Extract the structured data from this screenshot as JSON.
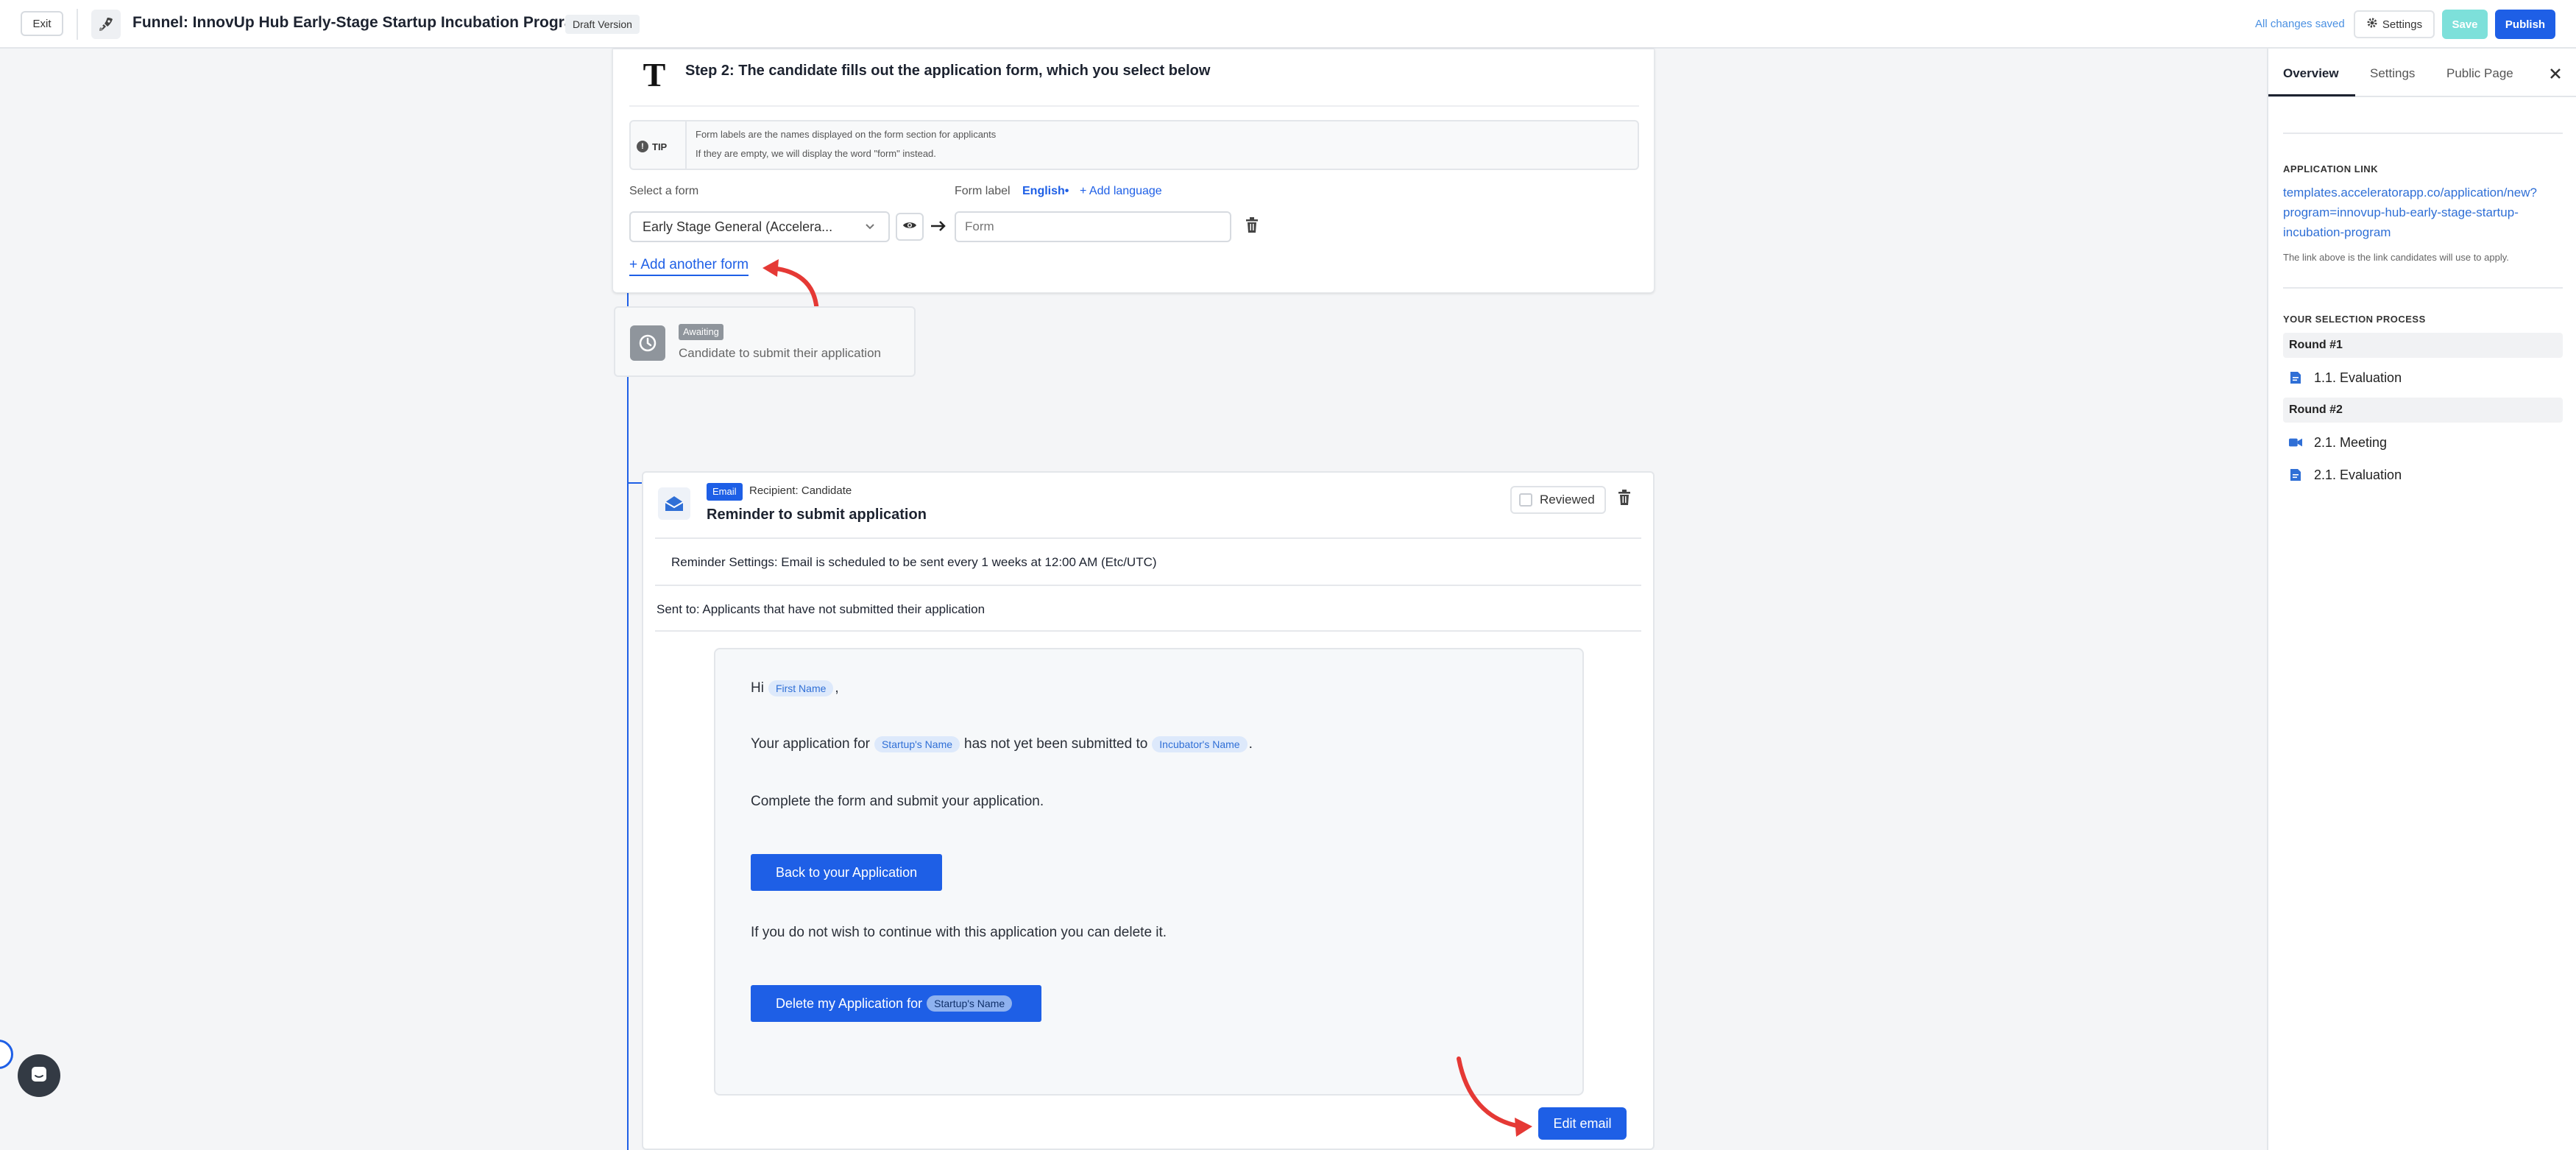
{
  "header": {
    "exit_label": "Exit",
    "title": "Funnel: InnovUp Hub Early-Stage Startup Incubation Program",
    "draft_label": "Draft Version",
    "saved_status": "All changes saved",
    "settings_label": "Settings",
    "save_label": "Save",
    "publish_label": "Publish"
  },
  "sidebar": {
    "tabs": [
      {
        "label": "Overview",
        "active": true
      },
      {
        "label": "Settings",
        "active": false
      },
      {
        "label": "Public Page",
        "active": false
      }
    ],
    "application_link_heading": "APPLICATION LINK",
    "application_link": "templates.acceleratorapp.co/application/new?program=innovup-hub-early-stage-startup-incubation-program",
    "application_link_note": "The link above is the link candidates will use to apply.",
    "selection_heading": "YOUR SELECTION PROCESS",
    "rounds": [
      {
        "label": "Round #1",
        "steps": [
          {
            "label": "1.1. Evaluation",
            "icon": "document-icon"
          }
        ]
      },
      {
        "label": "Round #2",
        "steps": [
          {
            "label": "2.1. Meeting",
            "icon": "video-camera-icon"
          },
          {
            "label": "2.1. Evaluation",
            "icon": "document-icon"
          }
        ]
      }
    ]
  },
  "step2": {
    "icon_letter": "T",
    "title": "Step 2: The candidate fills out the application form, which you select below",
    "tip_label": "TIP",
    "tip_line1": "Form labels are the names displayed on the form section for applicants",
    "tip_line2": "If they are empty, we will display the word \"form\" instead.",
    "select_form_label": "Select a form",
    "selected_form": "Early Stage General (Accelera...",
    "form_label_label": "Form label",
    "language": "English",
    "add_language": "+ Add language",
    "form_label_placeholder": "Form",
    "add_another_form": "+ Add another form"
  },
  "awaiting": {
    "badge": "Awaiting",
    "text": "Candidate to submit their application"
  },
  "email": {
    "badge": "Email",
    "recipient": "Recipient: Candidate",
    "title": "Reminder to submit application",
    "reviewed_label": "Reviewed",
    "reminder_settings": "Reminder Settings: Email is scheduled to be sent every 1 weeks at 12:00 AM (Etc/UTC)",
    "sent_to": "Sent to: Applicants that have not submitted their application",
    "preview": {
      "greeting": "Hi",
      "first_name_token": "First Name",
      "greeting_comma": ",",
      "line2_a": "Your application for",
      "startup_token": "Startup's Name",
      "line2_b": "has not yet been submitted to",
      "incubator_token": "Incubator's Name",
      "line2_end": ".",
      "line3": "Complete the form and submit your application.",
      "back_button": "Back to your Application",
      "line4": "If you do not wish to continue with this application you can delete it.",
      "delete_button": "Delete my Application for",
      "delete_token": "Startup's Name"
    },
    "edit_button": "Edit email"
  },
  "colors": {
    "accent": "#1e5fe6",
    "annotation_arrow": "#e53935",
    "save_disabled": "#7de0da"
  }
}
